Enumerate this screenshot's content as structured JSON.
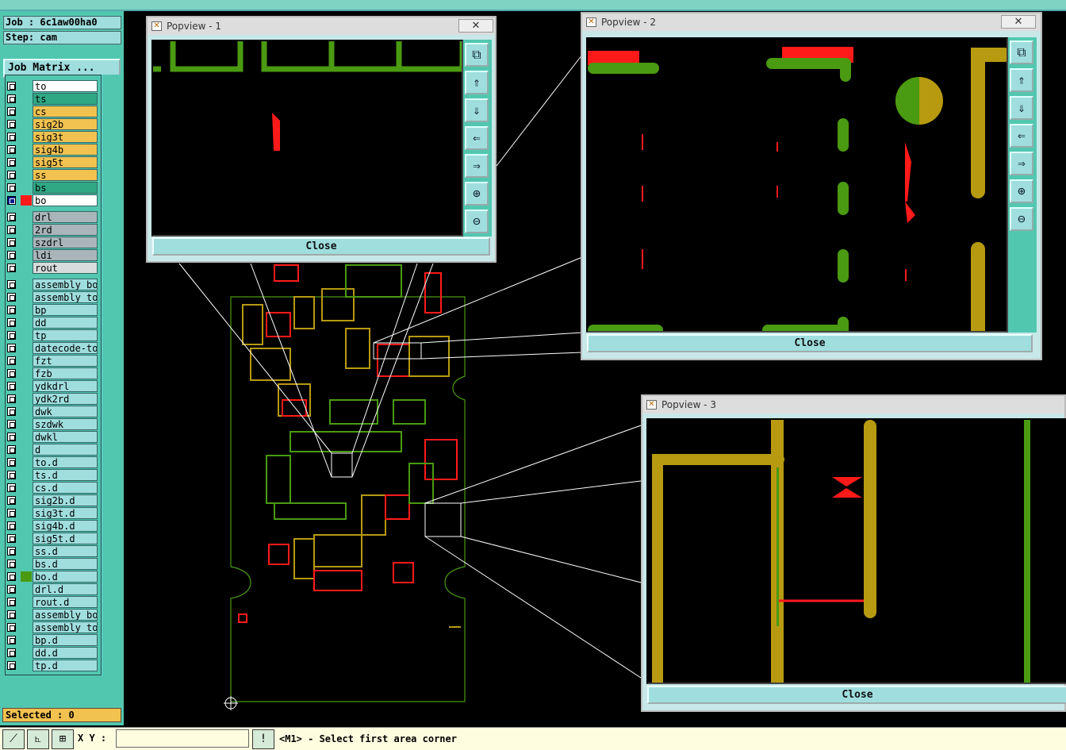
{
  "header": {
    "job_line": "Job : 6c1aw00ha0",
    "step_line": "Step: cam",
    "job_matrix_button": "Job Matrix ..."
  },
  "colors": {
    "panel_teal": "#52c7b0",
    "layer_orange": "#f2c250",
    "layer_green": "#2fa883",
    "layer_gray": "#a9b5bb",
    "layer_cyan": "#a0dede",
    "board_green": "#4a9a12",
    "board_gold": "#b79a10",
    "board_red": "#ff1a1a"
  },
  "layers": [
    {
      "name": "to",
      "color": "white"
    },
    {
      "name": "ts",
      "color": "green"
    },
    {
      "name": "cs",
      "color": "orange"
    },
    {
      "name": "sig2b",
      "color": "orange"
    },
    {
      "name": "sig3t",
      "color": "orange"
    },
    {
      "name": "sig4b",
      "color": "orange"
    },
    {
      "name": "sig5t",
      "color": "orange"
    },
    {
      "name": "ss",
      "color": "orange"
    },
    {
      "name": "bs",
      "color": "green"
    },
    {
      "name": "bo",
      "color": "white",
      "selected": true
    },
    {
      "name": "drl",
      "color": "gray"
    },
    {
      "name": "2rd",
      "color": "gray"
    },
    {
      "name": "szdrl",
      "color": "gray"
    },
    {
      "name": "ldi",
      "color": "gray"
    },
    {
      "name": "rout",
      "color": "lightgray"
    },
    {
      "name": "assembly_bot",
      "color": "cyan"
    },
    {
      "name": "assembly_top",
      "color": "cyan"
    },
    {
      "name": "bp",
      "color": "cyan"
    },
    {
      "name": "dd",
      "color": "cyan"
    },
    {
      "name": "tp",
      "color": "cyan"
    },
    {
      "name": "datecode-to",
      "color": "cyan"
    },
    {
      "name": "fzt",
      "color": "cyan"
    },
    {
      "name": "fzb",
      "color": "cyan"
    },
    {
      "name": "ydkdrl",
      "color": "cyan"
    },
    {
      "name": "ydk2rd",
      "color": "cyan"
    },
    {
      "name": "dwk",
      "color": "cyan"
    },
    {
      "name": "szdwk",
      "color": "cyan"
    },
    {
      "name": "dwkl",
      "color": "cyan"
    },
    {
      "name": "d",
      "color": "cyan"
    },
    {
      "name": "to.d",
      "color": "cyan"
    },
    {
      "name": "ts.d",
      "color": "cyan"
    },
    {
      "name": "cs.d",
      "color": "cyan"
    },
    {
      "name": "sig2b.d",
      "color": "cyan"
    },
    {
      "name": "sig3t.d",
      "color": "cyan"
    },
    {
      "name": "sig4b.d",
      "color": "cyan"
    },
    {
      "name": "sig5t.d",
      "color": "cyan"
    },
    {
      "name": "ss.d",
      "color": "cyan"
    },
    {
      "name": "bs.d",
      "color": "cyan"
    },
    {
      "name": "bo.d",
      "color": "cyan",
      "swatch": "green"
    },
    {
      "name": "drl.d",
      "color": "cyan"
    },
    {
      "name": "rout.d",
      "color": "cyan"
    },
    {
      "name": "assembly_bot",
      "color": "cyan"
    },
    {
      "name": "assembly_top",
      "color": "cyan"
    },
    {
      "name": "bp.d",
      "color": "cyan"
    },
    {
      "name": "dd.d",
      "color": "cyan"
    },
    {
      "name": "tp.d",
      "color": "cyan"
    }
  ],
  "status": {
    "selected": "Selected : 0",
    "xy_label": "X Y :",
    "xy_value": "",
    "prompt": "<M1> - Select first area corner"
  },
  "popups": [
    {
      "title": "Popview - 1",
      "close_label": "Close"
    },
    {
      "title": "Popview - 2",
      "close_label": "Close"
    },
    {
      "title": "Popview - 3",
      "close_label": "Close"
    }
  ],
  "icons": {
    "window_close": "✕",
    "zoom_tools": [
      "zoom-home-icon",
      "pan-up-icon",
      "pan-down-icon",
      "pan-left-icon",
      "pan-right-icon",
      "zoom-in-icon",
      "zoom-out-icon"
    ]
  }
}
